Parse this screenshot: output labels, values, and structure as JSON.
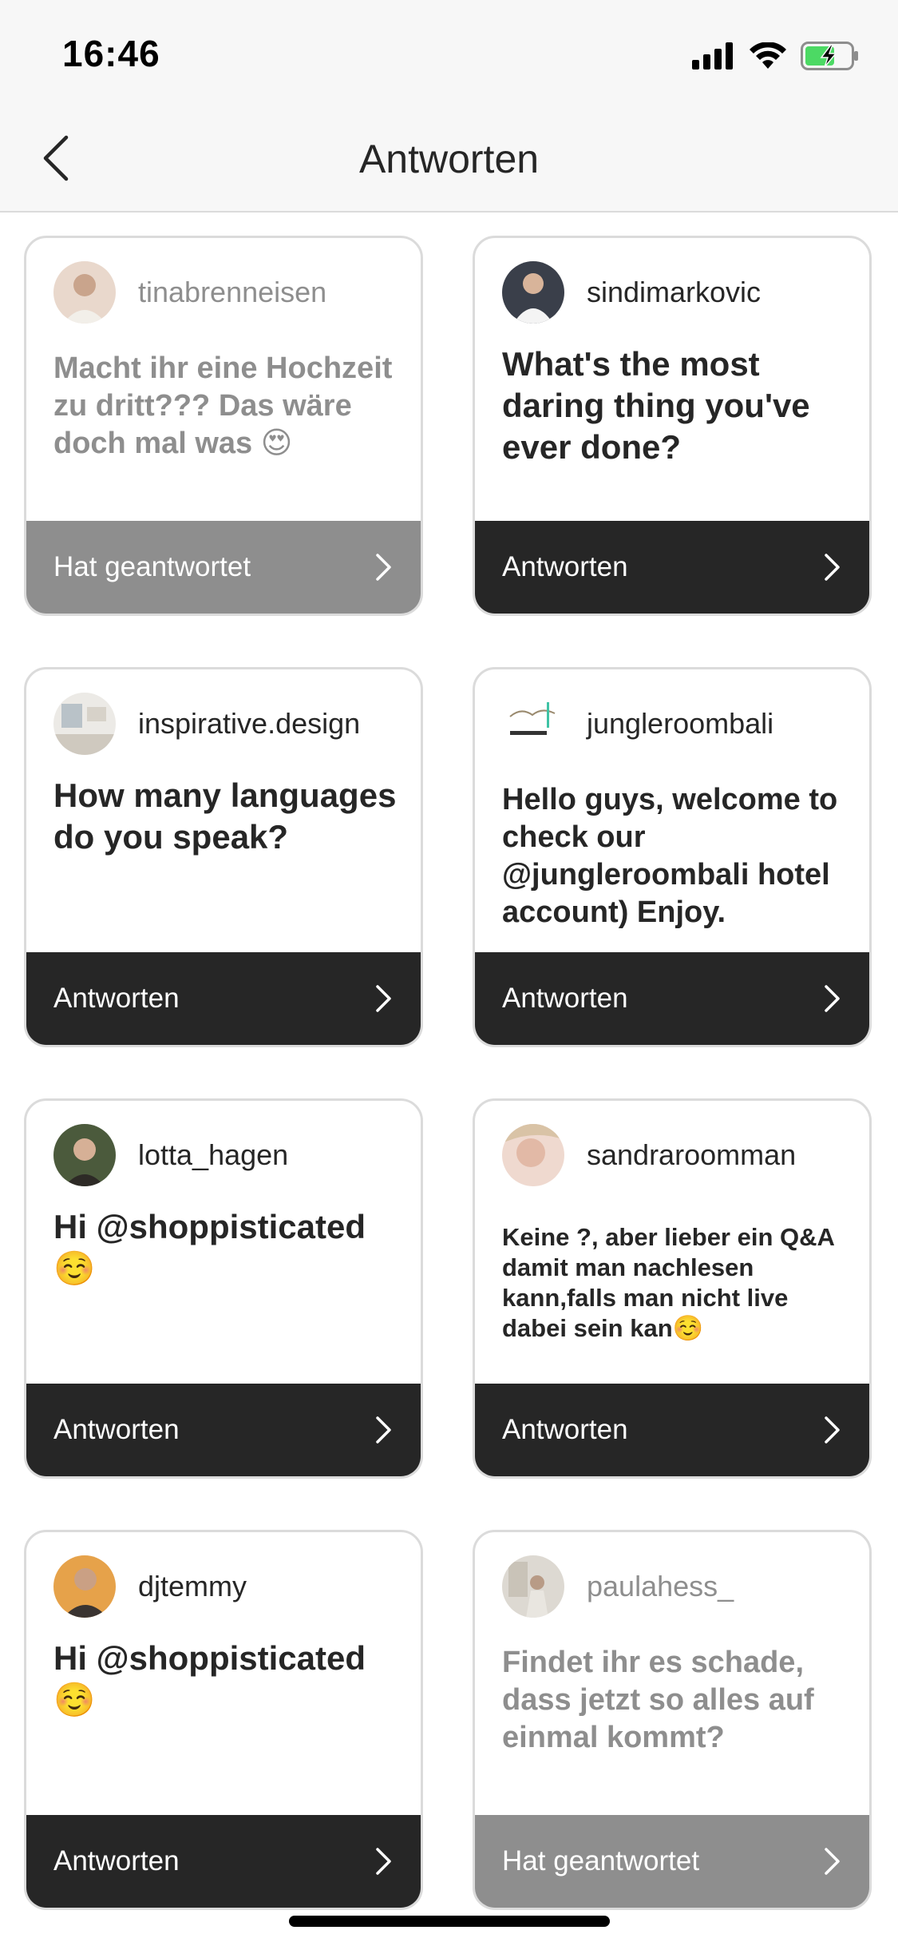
{
  "status_bar": {
    "time": "16:46",
    "icons": [
      "cellular-signal-icon",
      "wifi-icon",
      "battery-charging-icon"
    ]
  },
  "header": {
    "title": "Antworten",
    "back_icon": "chevron-left-icon"
  },
  "colors": {
    "active_footer": "#262626",
    "answered_footer": "#8e8e8e",
    "card_border": "#dbdbdb",
    "battery_fill": "#4cd964"
  },
  "cards": [
    {
      "username": "tinabrenneisen",
      "question": "Macht ihr eine Hochzeit zu dritt??? Das wäre doch mal was 😍",
      "footer": "Hat geantwortet",
      "answered": true
    },
    {
      "username": "sindimarkovic",
      "question": "What's the most daring thing you've ever done?",
      "footer": "Antworten",
      "answered": false
    },
    {
      "username": "inspirative.design",
      "question": "How many languages do you speak?",
      "footer": "Antworten",
      "answered": false
    },
    {
      "username": "jungleroombali",
      "question": "Hello guys, welcome to check our @jungleroombali hotel account) Enjoy.",
      "footer": "Antworten",
      "answered": false
    },
    {
      "username": "lotta_hagen",
      "question": "Hi @shoppisticated ☺️",
      "footer": "Antworten",
      "answered": false
    },
    {
      "username": "sandraroomman",
      "question": "Keine ?, aber lieber ein Q&A damit man nachlesen kann,falls man nicht live dabei sein kan☺️",
      "footer": "Antworten",
      "answered": false
    },
    {
      "username": "djtemmy",
      "question": "Hi @shoppisticated ☺️",
      "footer": "Antworten",
      "answered": false
    },
    {
      "username": "paulahess_",
      "question": "Findet ihr es schade, dass jetzt so alles auf einmal kommt?",
      "footer": "Hat geantwortet",
      "answered": true
    }
  ]
}
